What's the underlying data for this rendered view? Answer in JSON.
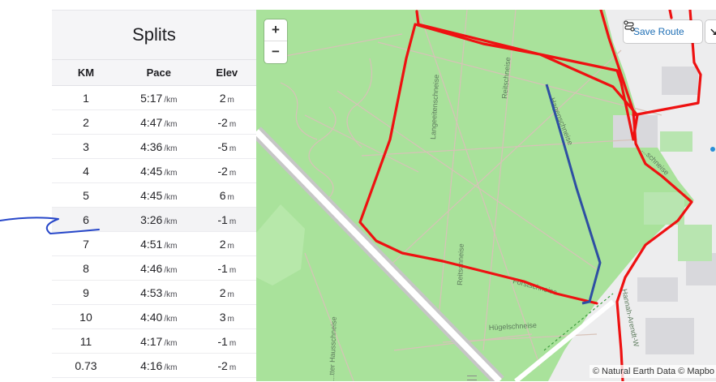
{
  "splits": {
    "title": "Splits",
    "columns": [
      "KM",
      "Pace",
      "Elev"
    ],
    "pace_unit": "/km",
    "elev_unit": "m",
    "rows": [
      {
        "km": "1",
        "pace": "5:17",
        "elev": "2"
      },
      {
        "km": "2",
        "pace": "4:47",
        "elev": "-2"
      },
      {
        "km": "3",
        "pace": "4:36",
        "elev": "-5"
      },
      {
        "km": "4",
        "pace": "4:45",
        "elev": "-2"
      },
      {
        "km": "5",
        "pace": "4:45",
        "elev": "6"
      },
      {
        "km": "6",
        "pace": "3:26",
        "elev": "-1"
      },
      {
        "km": "7",
        "pace": "4:51",
        "elev": "2"
      },
      {
        "km": "8",
        "pace": "4:46",
        "elev": "-1"
      },
      {
        "km": "9",
        "pace": "4:53",
        "elev": "2"
      },
      {
        "km": "10",
        "pace": "4:40",
        "elev": "3"
      },
      {
        "km": "11",
        "pace": "4:17",
        "elev": "-1"
      },
      {
        "km": "0.73",
        "pace": "4:16",
        "elev": "-2"
      }
    ],
    "highlighted_row": "6"
  },
  "map": {
    "zoom_in_label": "+",
    "zoom_out_label": "−",
    "save_route_label": "Save Route",
    "attribution": "© Natural Earth Data © Mapbo",
    "street_labels": {
      "langeeiten": "Langeeitenschneise",
      "reits_upper": "Reitschneise",
      "reits_lower": "Reitschneise",
      "hagen": "Hagenschneise",
      "forst": "Forstschneise",
      "huegel": "Hügelschneise",
      "hausschneise": "...tter Hausschneise",
      "hannah": "Hannah-Arendt-W",
      "nord": "...schneise"
    },
    "colors": {
      "park": "#a9e29b",
      "route": "#ee1111",
      "segment": "#2e4fa3",
      "accent": "#1f6fb5"
    }
  }
}
